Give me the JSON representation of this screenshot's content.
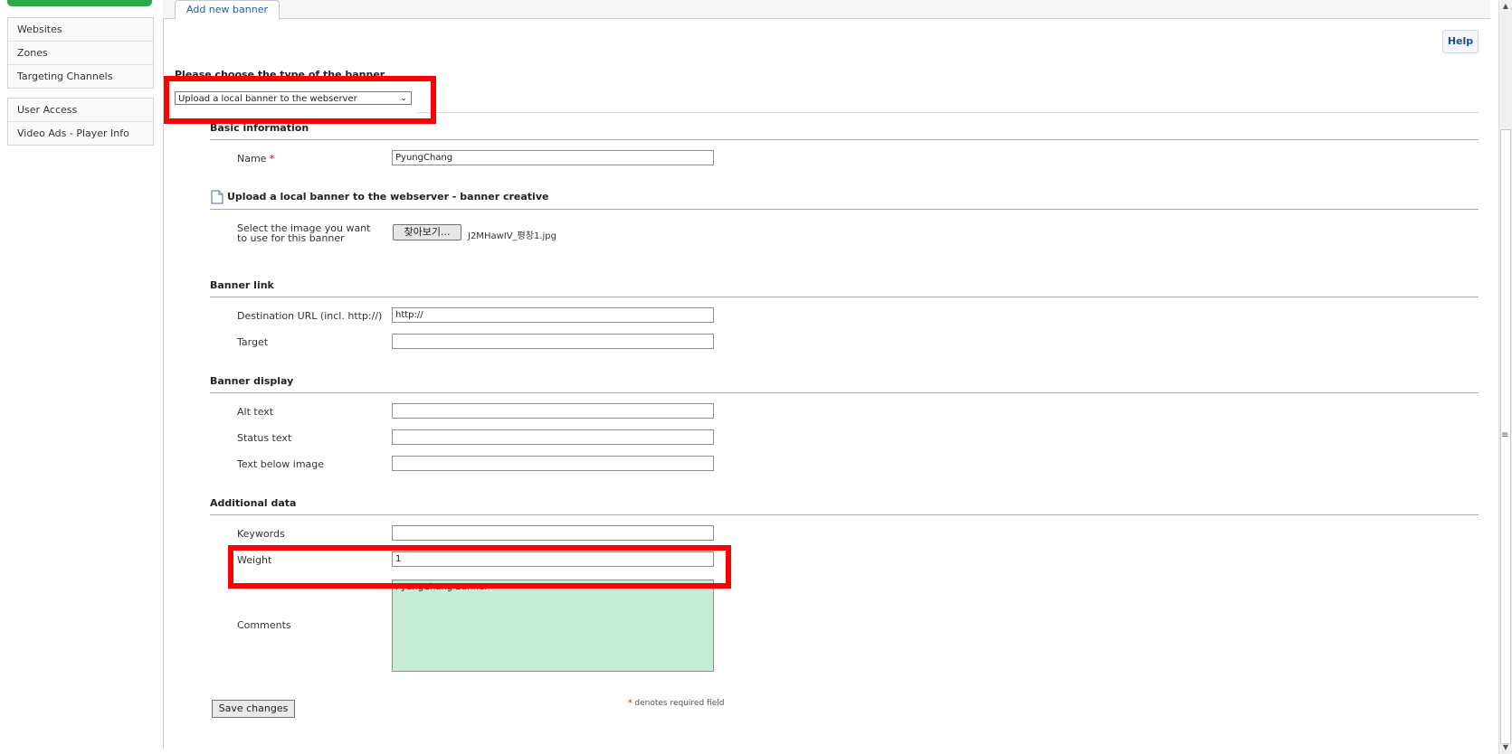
{
  "sidebar": {
    "groups": [
      [
        "Websites",
        "Zones",
        "Targeting Channels"
      ],
      [
        "User Access",
        "Video Ads - Player Info"
      ]
    ]
  },
  "tabs": {
    "active": "Add new banner"
  },
  "help_label": "Help",
  "banner_type": {
    "label": "Please choose the type of the banner",
    "selected": "Upload a local banner to the webserver",
    "arrow_icon": "chevron-down-icon"
  },
  "sections": {
    "basic": {
      "title": "Basic information",
      "name_label": "Name",
      "required_star": "*",
      "name_value": "PyungChang"
    },
    "creative": {
      "title": "Upload a local banner to the webserver - banner creative",
      "icon": "document-icon",
      "image_label_line1": "Select the image you want",
      "image_label_line2": "to use for this banner",
      "browse_button": "찾아보기...",
      "file_name": "J2MHawIV_평창1.jpg"
    },
    "link": {
      "title": "Banner link",
      "url_label": "Destination URL (incl. http://)",
      "url_value": "http://",
      "target_label": "Target",
      "target_value": ""
    },
    "display": {
      "title": "Banner display",
      "alt_label": "Alt text",
      "status_label": "Status text",
      "below_label": "Text below image"
    },
    "additional": {
      "title": "Additional data",
      "keywords_label": "Keywords",
      "weight_label": "Weight",
      "weight_value": "1",
      "comments_label": "Comments",
      "comments_value": "PyungChang Banner"
    }
  },
  "save_button": "Save changes",
  "required_note": {
    "star": "*",
    "text": "denotes required field"
  },
  "colors": {
    "highlight": "#ff0000",
    "comments_bg": "#c6ebd7",
    "tab_text": "#2a5aa0",
    "sidebar_accent": "#2aa84a"
  }
}
